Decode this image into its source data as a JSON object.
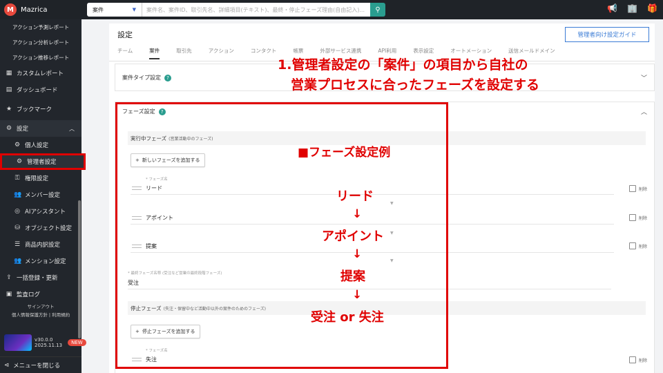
{
  "topbar": {
    "app_name": "Mazrica",
    "logo_letter": "M",
    "search_select": "案件",
    "search_placeholder": "案件名、案件ID、取引先名、詳細項目(テキスト)、最終・停止フェーズ理由(自由記入)...",
    "icons": [
      "megaphone-icon",
      "building-icon",
      "gift-icon"
    ]
  },
  "sidebar": {
    "top_items": [
      "アクション予測レポート",
      "アクション分析レポート",
      "アクション推移レポート"
    ],
    "items": [
      {
        "label": "カスタムレポート",
        "icon": "report-icon"
      },
      {
        "label": "ダッシュボード",
        "icon": "dashboard-icon"
      },
      {
        "label": "ブックマーク",
        "icon": "star-icon"
      },
      {
        "label": "設定",
        "icon": "gear-icon"
      },
      {
        "label": "個人設定",
        "icon": "gear-icon"
      },
      {
        "label": "管理者設定",
        "icon": "gear-icon"
      },
      {
        "label": "権限設定",
        "icon": "key-icon"
      },
      {
        "label": "メンバー設定",
        "icon": "users-icon"
      },
      {
        "label": "AIアシスタント",
        "icon": "ai-icon"
      },
      {
        "label": "オブジェクト設定",
        "icon": "database-icon"
      },
      {
        "label": "商品内訳設定",
        "icon": "list-icon"
      },
      {
        "label": "メンション設定",
        "icon": "users-icon"
      },
      {
        "label": "一括登録・更新",
        "icon": "import-icon"
      },
      {
        "label": "監査ログ",
        "icon": "log-icon"
      }
    ],
    "signout": "サインアウト",
    "links": "個人情報保護方針 | 利用規約",
    "version": "v30.0.0",
    "version_date": "2025.11.13",
    "new_badge": "NEW",
    "close_menu": "メニューを閉じる"
  },
  "main": {
    "title": "設定",
    "guide_button": "管理者向け設定ガイド",
    "tabs": [
      "チーム",
      "案件",
      "取引先",
      "アクション",
      "コンタクト",
      "帳票",
      "外部サービス連携",
      "API利用",
      "表示設定",
      "オートメーション",
      "送信メールドメイン"
    ],
    "active_tab": "案件",
    "panel1_title": "案件タイプ設定",
    "panel2_title": "フェーズ設定",
    "running_section": "実行中フェーズ",
    "running_note": "(営業活動中のフェーズ)",
    "add_phase": "新しいフェーズを追加する",
    "phase_name_label": "* フェーズ名",
    "phases": [
      "リード",
      "アポイント",
      "提案"
    ],
    "delete_label": "削除",
    "final_label": "* 最終フェーズ名称",
    "final_note": "(受注など営業の最終段階フェーズ)",
    "final_value": "受注",
    "stop_section": "停止フェーズ",
    "stop_note": "(失注・保留中など活動中以外の案件のためのフェーズ)",
    "add_stop_phase": "停止フェーズを追加する",
    "stop_phase_label": "* フェーズ名",
    "stop_phase_value": "失注"
  },
  "annotation": {
    "line1": "1.管理者設定の「案件」の項目から自社の",
    "line2": "営業プロセスに合ったフェーズを設定する",
    "example_title": "■フェーズ設定例",
    "flow": [
      "リード",
      "アポイント",
      "提案",
      "受注 or 失注"
    ],
    "arrow": "↓"
  },
  "colors": {
    "accent_red": "#e00000",
    "teal": "#2a9d8f",
    "blue": "#3a7bd5"
  }
}
